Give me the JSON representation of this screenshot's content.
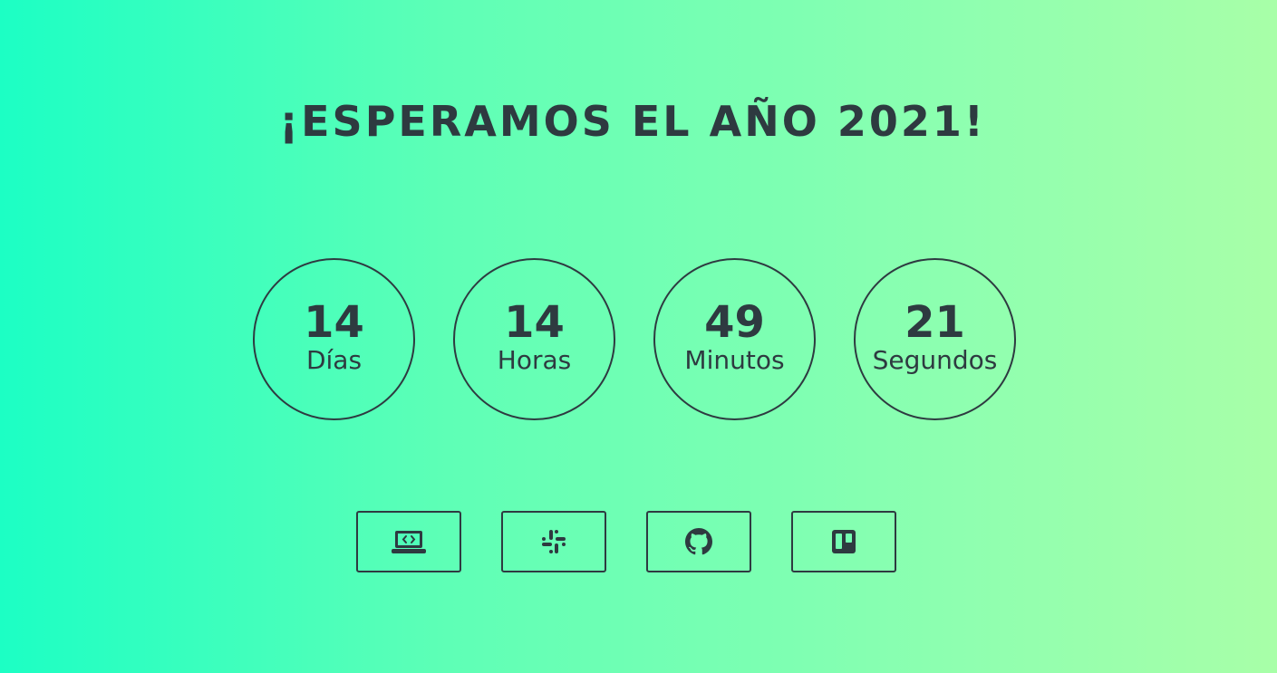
{
  "title": "¡ESPERAMOS EL AÑO 2021!",
  "countdown": [
    {
      "value": "14",
      "label": "Días"
    },
    {
      "value": "14",
      "label": "Horas"
    },
    {
      "value": "49",
      "label": "Minutos"
    },
    {
      "value": "21",
      "label": "Segundos"
    }
  ],
  "links": [
    {
      "icon": "laptop-code-icon"
    },
    {
      "icon": "slack-icon"
    },
    {
      "icon": "github-icon"
    },
    {
      "icon": "trello-icon"
    }
  ],
  "colors": {
    "text": "#2e3a40",
    "gradient_start": "#1cffc4",
    "gradient_end": "#a8ffa8"
  }
}
